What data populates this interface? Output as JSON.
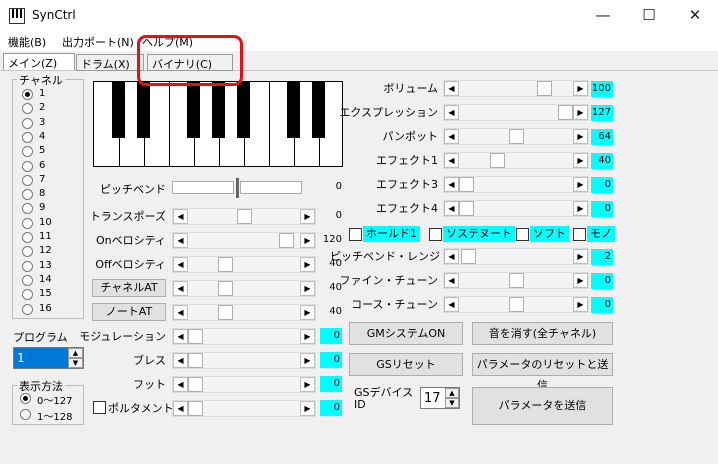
{
  "window": {
    "title": "SynCtrl",
    "minimize": "—",
    "maximize": "☐",
    "close": "✕"
  },
  "menu": [
    "機能(B)",
    "出力ポート(N)",
    "ヘルプ(M)"
  ],
  "tabs": [
    "メイン(Z)",
    "ドラム(X)",
    "バイナリ(C)"
  ],
  "channel": {
    "label": "チャネル",
    "items": [
      "1",
      "2",
      "3",
      "4",
      "5",
      "6",
      "7",
      "8",
      "9",
      "10",
      "11",
      "12",
      "13",
      "14",
      "15",
      "16"
    ],
    "selected": 0
  },
  "program": {
    "label": "プログラム",
    "value": "1"
  },
  "display": {
    "label": "表示方法",
    "options": [
      "0〜127",
      "1〜128"
    ],
    "selected": 0
  },
  "pitchbend": {
    "label": "ピッチベンド",
    "value": "0"
  },
  "left_sliders": [
    {
      "label": "トランスポーズ",
      "value": "0",
      "pos": 0.5
    },
    {
      "label": "Onベロシティ",
      "value": "120",
      "pos": 0.94
    },
    {
      "label": "Offベロシティ",
      "value": "40",
      "pos": 0.31
    },
    {
      "label": "チャネルAT",
      "value": "40",
      "pos": 0.31,
      "button": true
    },
    {
      "label": "ノートAT",
      "value": "40",
      "pos": 0.31,
      "button": true
    },
    {
      "label": "モジュレーション",
      "value": "0",
      "pos": 0,
      "cyan": true
    },
    {
      "label": "ブレス",
      "value": "0",
      "pos": 0,
      "cyan": true
    },
    {
      "label": "フット",
      "value": "0",
      "pos": 0,
      "cyan": true
    },
    {
      "label": "ポルタメント",
      "value": "0",
      "pos": 0,
      "cyan": true,
      "checkbox": true
    }
  ],
  "right_sliders": [
    {
      "label": "ボリューム",
      "value": "100",
      "pos": 0.79
    },
    {
      "label": "エクスプレッション",
      "value": "127",
      "pos": 1.0
    },
    {
      "label": "パンポット",
      "value": "64",
      "pos": 0.5
    },
    {
      "label": "エフェクト1",
      "value": "40",
      "pos": 0.31
    },
    {
      "label": "エフェクト3",
      "value": "0",
      "pos": 0
    },
    {
      "label": "エフェクト4",
      "value": "0",
      "pos": 0
    }
  ],
  "toggles": [
    "ホールド1",
    "ソステヌート",
    "ソフト",
    "モノ"
  ],
  "right_sliders2": [
    {
      "label": "ピッチベンド・レンジ",
      "value": "2",
      "pos": 0.02
    },
    {
      "label": "ファイン・チューン",
      "value": "0",
      "pos": 0.5
    },
    {
      "label": "コース・チューン",
      "value": "0",
      "pos": 0.5
    }
  ],
  "buttons": {
    "gm_on": "GMシステムON",
    "mute_all": "音を消す(全チャネル)",
    "gs_reset": "GSリセット",
    "reset_send": "パラメータのリセットと送信",
    "send": "パラメータを送信"
  },
  "gs_device": {
    "label": "GSデバイス\nID",
    "value": "17"
  }
}
